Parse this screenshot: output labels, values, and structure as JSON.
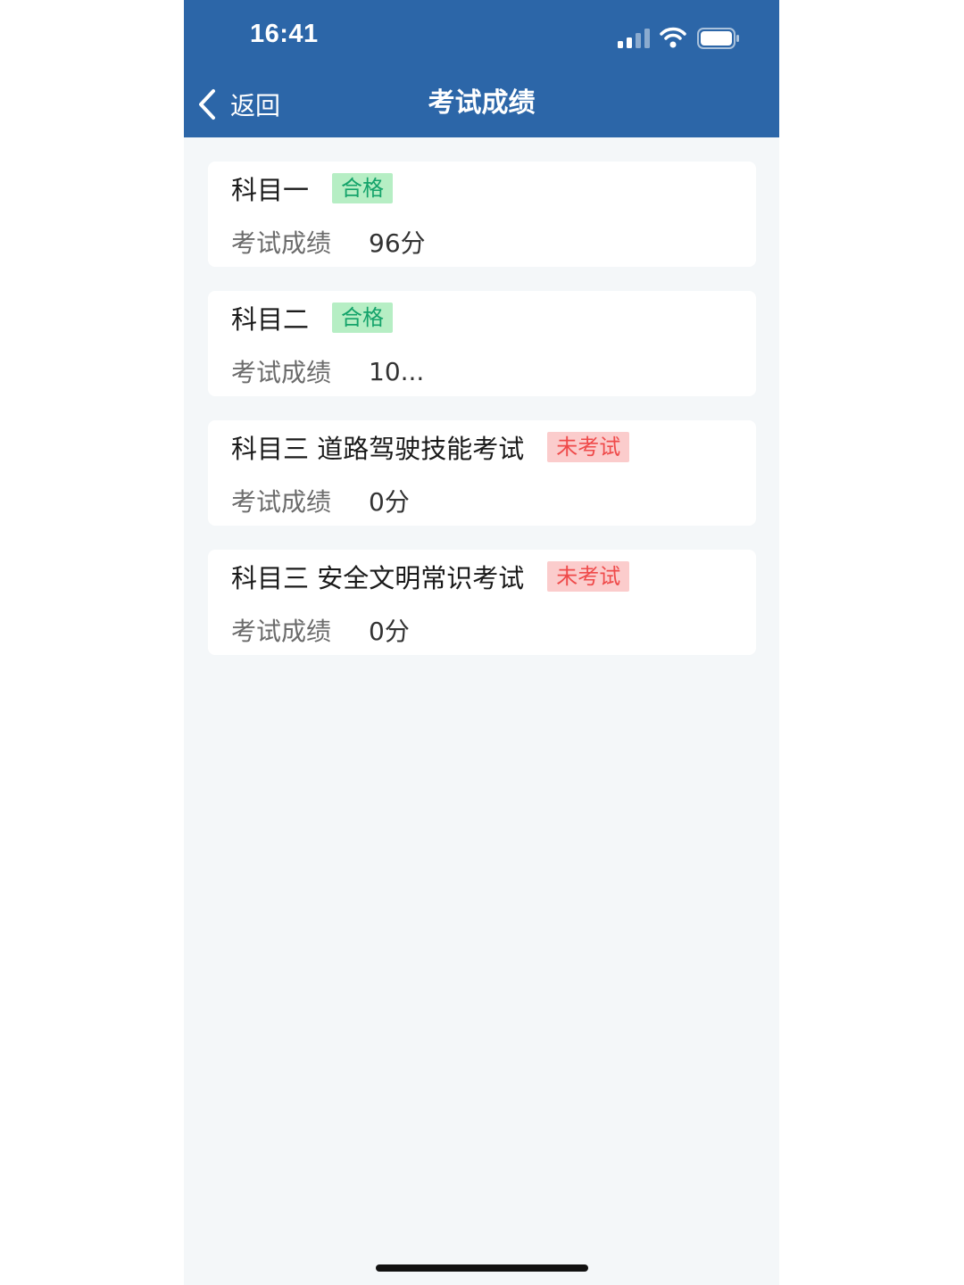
{
  "status_bar": {
    "time": "16:41"
  },
  "nav": {
    "back_label": "返回",
    "title": "考试成绩"
  },
  "exams": [
    {
      "subject": "科目一",
      "badge": "合格",
      "status": "pass",
      "score_label": "考试成绩",
      "score": "96分"
    },
    {
      "subject": "科目二",
      "badge": "合格",
      "status": "pass",
      "score_label": "考试成绩",
      "score": "10..."
    },
    {
      "subject": "科目三 道路驾驶技能考试",
      "badge": "未考试",
      "status": "fail",
      "score_label": "考试成绩",
      "score": "0分"
    },
    {
      "subject": "科目三 安全文明常识考试",
      "badge": "未考试",
      "status": "fail",
      "score_label": "考试成绩",
      "score": "0分"
    }
  ],
  "colors": {
    "header_bg": "#2c66a8",
    "page_bg": "#f4f7f9",
    "pass_bg": "#b6eec4",
    "pass_text": "#14a36a",
    "fail_bg": "#fbcccc",
    "fail_text": "#ef4a4a"
  },
  "icons": [
    "signal-icon",
    "wifi-icon",
    "battery-icon",
    "chevron-left-icon"
  ]
}
